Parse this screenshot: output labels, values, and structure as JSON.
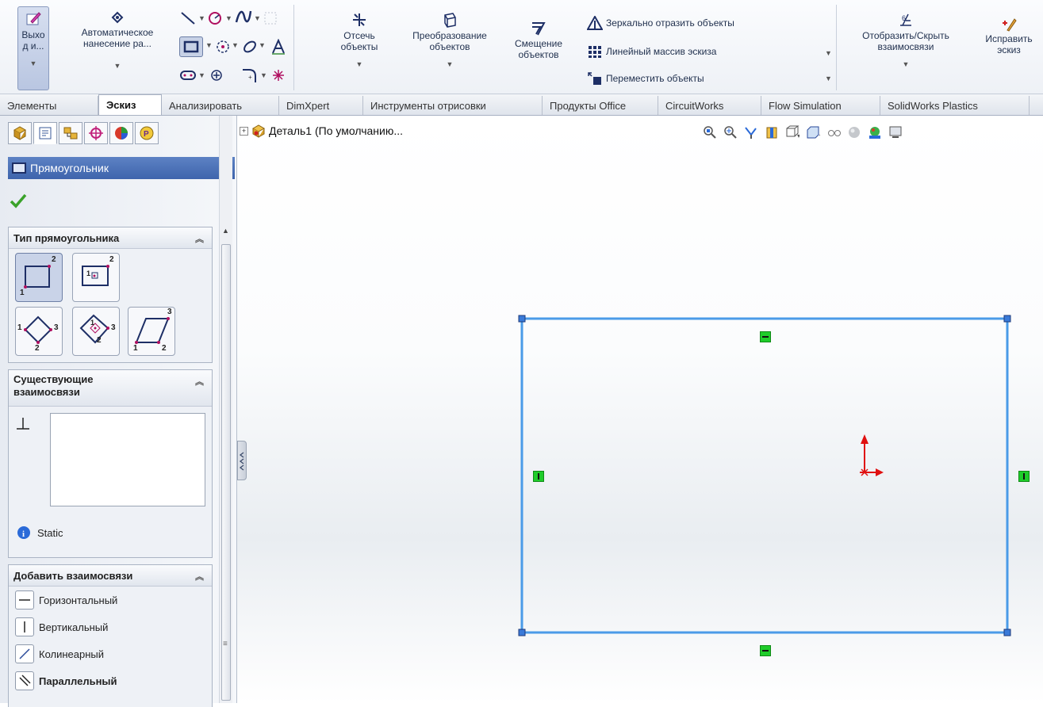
{
  "ribbon": {
    "exit_label": "Выхо\nд и...",
    "auto_dim_label": "Автоматическое\nнанесение ра...",
    "trim_label": "Отсечь\nобъекты",
    "convert_label": "Преобразование\nобъектов",
    "offset_label": "Смещение\nобъектов",
    "mirror_label": "Зеркально отразить объекты",
    "linear_pattern_label": "Линейный массив эскиза",
    "move_label": "Переместить объекты",
    "show_hide_label": "Отобразить/Скрыть\nвзаимосвязи",
    "repair_label": "Исправить\nэскиз"
  },
  "tabs": [
    {
      "label": "Элементы"
    },
    {
      "label": "Эскиз",
      "active": true
    },
    {
      "label": "Анализировать"
    },
    {
      "label": "DimXpert"
    },
    {
      "label": "Инструменты отрисовки"
    },
    {
      "label": "Продукты Office"
    },
    {
      "label": "CircuitWorks"
    },
    {
      "label": "Flow Simulation"
    },
    {
      "label": "SolidWorks Plastics"
    }
  ],
  "property_manager": {
    "title": "Прямоугольник",
    "help": "?",
    "rect_type": {
      "heading": "Тип прямоугольника",
      "labels": {
        "corner_2": "2",
        "corner_1": "1",
        "center_2": "2",
        "center_1": "1",
        "three_1": "1",
        "three_2": "2",
        "three_3": "3",
        "three_center_1": "1",
        "three_center_2": "2",
        "three_center_3": "3",
        "para_1": "1",
        "para_2": "2",
        "para_3": "3"
      }
    },
    "existing_relations": {
      "heading": "Существующие\nвзаимосвязи",
      "status": "Static"
    },
    "add_relations": {
      "heading": "Добавить взаимосвязи",
      "items": [
        {
          "label": "Горизонтальный",
          "bold": false
        },
        {
          "label": "Вертикальный",
          "bold": false
        },
        {
          "label": "Колинеарный",
          "bold": false
        },
        {
          "label": "Параллельный",
          "bold": true
        }
      ]
    }
  },
  "feature_tree": {
    "item_label": "Деталь1  (По умолчанию..."
  },
  "colors": {
    "sketch_line": "#4a9be8",
    "relation_glyph": "#1fcc2a",
    "origin_red": "#e01010",
    "pm_title_bg": "#4a6fb5"
  }
}
